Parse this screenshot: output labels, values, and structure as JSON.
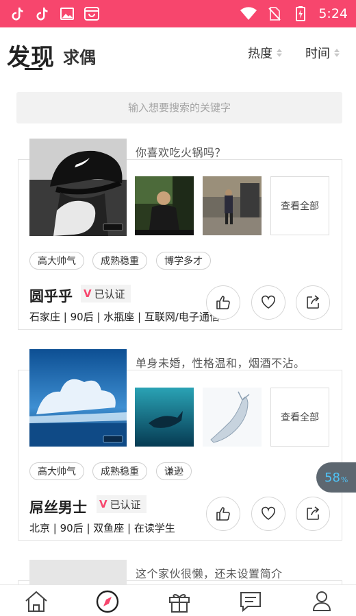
{
  "status_bar": {
    "time": "5:24",
    "left_icons": [
      "tiktok-icon",
      "tiktok-icon",
      "image-icon",
      "shopping-bag-icon"
    ],
    "right_icons": [
      "wifi-icon",
      "no-sim-icon",
      "battery-charging-icon"
    ]
  },
  "header": {
    "title": "发现",
    "subtitle": "求偶",
    "sort_hot": "热度",
    "sort_time": "时间"
  },
  "search": {
    "placeholder": "输入想要搜索的关键字"
  },
  "cards": [
    {
      "quote": "你喜欢吃火锅吗？",
      "tags": [
        "高大帅气",
        "成熟稳重",
        "博学多才"
      ],
      "name": "圆乎乎",
      "verified": "已认证",
      "info": "石家庄 | 90后 | 水瓶座 | 互联网/电子通信",
      "view_all": "查看全部"
    },
    {
      "quote": "单身未婚，性格温和，烟酒不沾。",
      "tags": [
        "高大帅气",
        "成熟稳重",
        "谦逊"
      ],
      "name": "屌丝男士",
      "verified": "已认证",
      "info": "北京 | 90后 | 双鱼座 | 在读学生",
      "view_all": "查看全部"
    },
    {
      "quote": "这个家伙很懒，还未设置简介"
    }
  ],
  "floating_badge": {
    "value": "58",
    "unit": "%"
  },
  "bottom_nav": [
    "home-icon",
    "compass-icon",
    "gift-icon",
    "message-icon",
    "profile-icon"
  ],
  "colors": {
    "accent": "#f7466d",
    "card_border": "#e2e2e2",
    "search_bg": "#f2f2f2"
  }
}
